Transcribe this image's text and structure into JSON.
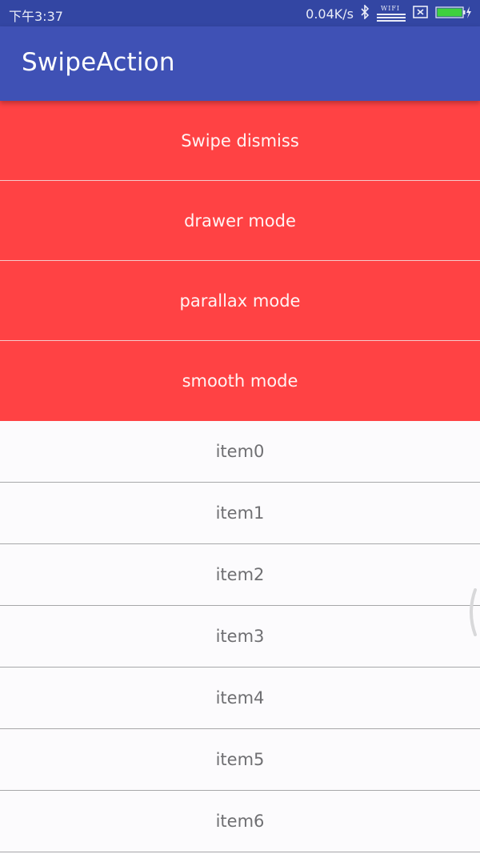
{
  "status_bar": {
    "time": "下午3:37",
    "net_speed": "0.04K/s",
    "wifi_label": "WIFI",
    "icons": [
      "bluetooth-icon",
      "wifi-icon",
      "sim-off-icon",
      "battery-charging-icon"
    ],
    "battery_color": "#3ed13e"
  },
  "app_bar": {
    "title": "SwipeAction",
    "color": "#3f51b5"
  },
  "actions": [
    {
      "label": "Swipe dismiss"
    },
    {
      "label": "drawer mode"
    },
    {
      "label": "parallax mode"
    },
    {
      "label": "smooth mode"
    }
  ],
  "action_color": "#ff4244",
  "items": [
    {
      "label": "item0"
    },
    {
      "label": "item1"
    },
    {
      "label": "item2"
    },
    {
      "label": "item3"
    },
    {
      "label": "item4"
    },
    {
      "label": "item5"
    },
    {
      "label": "item6"
    }
  ]
}
